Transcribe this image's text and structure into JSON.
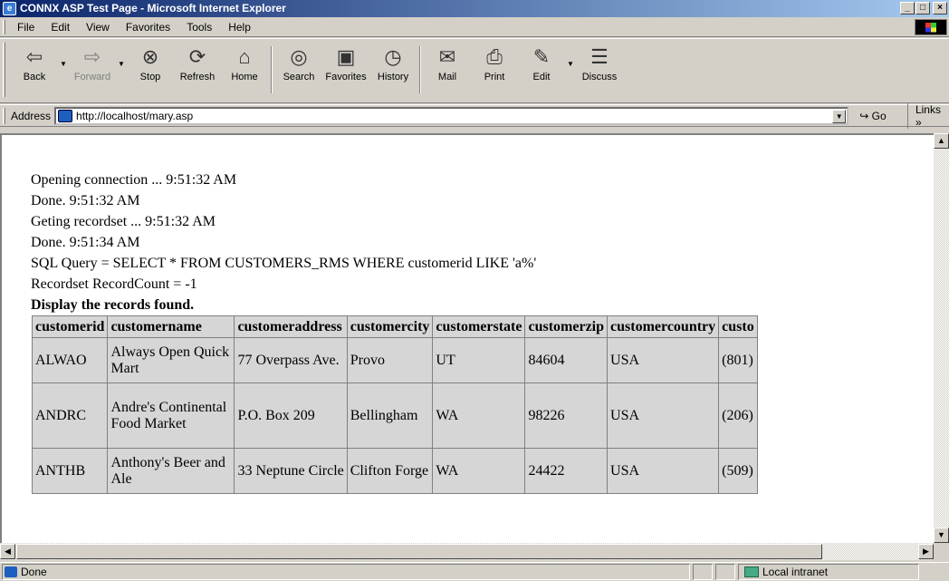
{
  "window": {
    "title": "CONNX ASP Test Page - Microsoft Internet Explorer",
    "controls": {
      "minimize": "_",
      "maximize": "□",
      "close": "×"
    }
  },
  "menu": {
    "items": [
      "File",
      "Edit",
      "View",
      "Favorites",
      "Tools",
      "Help"
    ]
  },
  "toolbar": {
    "buttons": [
      {
        "label": "Back",
        "icon": "back-arrow-icon",
        "enabled": true
      },
      {
        "label": "Forward",
        "icon": "forward-arrow-icon",
        "enabled": false
      },
      {
        "label": "Stop",
        "icon": "stop-icon",
        "enabled": true
      },
      {
        "label": "Refresh",
        "icon": "refresh-icon",
        "enabled": true
      },
      {
        "label": "Home",
        "icon": "home-icon",
        "enabled": true
      },
      {
        "label": "Search",
        "icon": "search-icon",
        "enabled": true
      },
      {
        "label": "Favorites",
        "icon": "favorites-icon",
        "enabled": true
      },
      {
        "label": "History",
        "icon": "history-icon",
        "enabled": true
      },
      {
        "label": "Mail",
        "icon": "mail-icon",
        "enabled": true
      },
      {
        "label": "Print",
        "icon": "print-icon",
        "enabled": true
      },
      {
        "label": "Edit",
        "icon": "edit-icon",
        "enabled": true
      },
      {
        "label": "Discuss",
        "icon": "discuss-icon",
        "enabled": true
      }
    ]
  },
  "address": {
    "label": "Address",
    "url": "http://localhost/mary.asp",
    "go_label": "Go",
    "links_label": "Links »"
  },
  "content": {
    "lines": [
      "Opening connection ... 9:51:32 AM",
      "Done. 9:51:32 AM",
      "Geting recordset ... 9:51:32 AM",
      "Done. 9:51:34 AM",
      "SQL Query = SELECT * FROM CUSTOMERS_RMS WHERE customerid LIKE 'a%'",
      "Recordset RecordCount = -1"
    ],
    "heading": "Display the records found.",
    "table": {
      "columns": [
        "customerid",
        "customername",
        "customeraddress",
        "customercity",
        "customerstate",
        "customerzip",
        "customercountry",
        "custo"
      ],
      "rows": [
        [
          "ALWAO",
          "Always Open Quick Mart",
          "77 Overpass Ave.",
          "Provo",
          "UT",
          "84604",
          "USA",
          "(801)"
        ],
        [
          "ANDRC",
          "Andre's Continental Food Market",
          "P.O. Box 209",
          "Bellingham",
          "WA",
          "98226",
          "USA",
          "(206)"
        ],
        [
          "ANTHB",
          "Anthony's Beer and Ale",
          "33 Neptune Circle",
          "Clifton Forge",
          "WA",
          "24422",
          "USA",
          "(509)"
        ]
      ]
    }
  },
  "status": {
    "text": "Done",
    "zone": "Local intranet"
  }
}
